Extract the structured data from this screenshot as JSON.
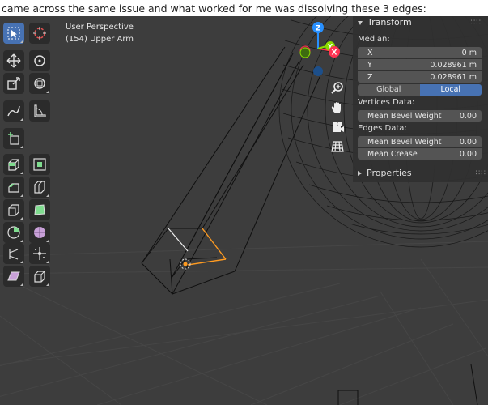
{
  "caption": "came across the same issue and what worked for me was dissolving these 3 edges:",
  "viewport": {
    "view_name": "User Perspective",
    "object_label": "(154) Upper Arm"
  },
  "toolbar": {
    "tools": [
      {
        "name": "select-box-icon",
        "active": true
      },
      {
        "name": "cursor-icon",
        "active": false
      },
      {
        "name": "move-icon",
        "active": false
      },
      {
        "name": "rotate-icon",
        "active": false
      },
      {
        "name": "scale-icon",
        "active": false
      },
      {
        "name": "transform-icon",
        "active": false
      },
      {
        "name": "annotate-icon",
        "active": false
      },
      {
        "name": "measure-icon",
        "active": false
      },
      {
        "name": "add-cube-icon",
        "active": false
      },
      {
        "name": "extrude-icon",
        "active": false
      },
      {
        "name": "inset-icon",
        "active": false
      },
      {
        "name": "bevel-icon",
        "active": false
      },
      {
        "name": "loop-cut-icon",
        "active": false
      },
      {
        "name": "knife-icon",
        "active": false
      },
      {
        "name": "poly-build-icon",
        "active": false
      },
      {
        "name": "spin-icon",
        "active": false
      },
      {
        "name": "smooth-icon",
        "active": false
      },
      {
        "name": "edge-slide-icon",
        "active": false
      },
      {
        "name": "randomize-icon",
        "active": false
      },
      {
        "name": "shear-icon",
        "active": false
      },
      {
        "name": "rip-icon",
        "active": false
      }
    ]
  },
  "gizmo": {
    "z_label": "Z",
    "y_label": "Y",
    "x_label": "X",
    "colors": {
      "x": "#ff3352",
      "y": "#8bdc00",
      "z": "#2890ff"
    }
  },
  "npanel": {
    "transform_header": "Transform",
    "median_label": "Median:",
    "fields": [
      {
        "axis": "X",
        "value": "0 m"
      },
      {
        "axis": "Y",
        "value": "0.028961 m"
      },
      {
        "axis": "Z",
        "value": "0.028961 m"
      }
    ],
    "space_global": "Global",
    "space_local": "Local",
    "vertices_label": "Vertices Data:",
    "vertex_bevel_label": "Mean Bevel Weight",
    "vertex_bevel_value": "0.00",
    "edges_label": "Edges Data:",
    "edge_bevel_label": "Mean Bevel Weight",
    "edge_bevel_value": "0.00",
    "edge_crease_label": "Mean Crease",
    "edge_crease_value": "0.00",
    "properties_header": "Properties"
  },
  "colors": {
    "viewport_bg": "#3d3d3d",
    "active_blue": "#4772b3",
    "selected_edge": "#ff9b21"
  }
}
